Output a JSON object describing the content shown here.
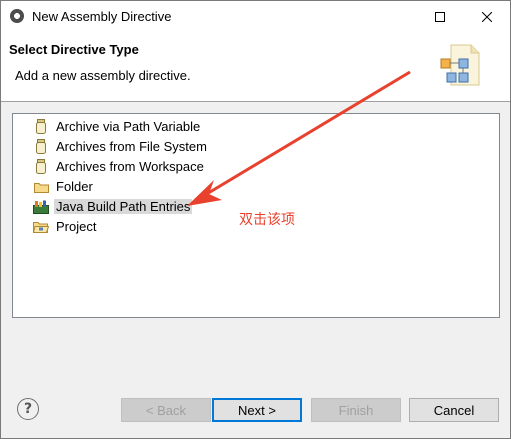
{
  "window": {
    "title": "New Assembly Directive",
    "controls": [
      "maximize-icon",
      "close-icon"
    ]
  },
  "header": {
    "title": "Select Directive Type",
    "description": "Add a new assembly directive.",
    "icon": "wizard-banner-icon"
  },
  "tree": {
    "items": [
      {
        "label": "Archive via Path Variable",
        "icon": "jar-icon"
      },
      {
        "label": "Archives from File System",
        "icon": "jar-icon"
      },
      {
        "label": "Archives from Workspace",
        "icon": "jar-icon"
      },
      {
        "label": "Folder",
        "icon": "folder-icon"
      },
      {
        "label": "Java Build Path Entries",
        "icon": "library-icon",
        "selected": true
      },
      {
        "label": "Project",
        "icon": "project-icon"
      }
    ]
  },
  "annotation": {
    "text": "双击该项",
    "color": "#e8412e"
  },
  "buttons": {
    "help": "?",
    "back": "< Back",
    "next": "Next >",
    "finish": "Finish",
    "cancel": "Cancel"
  },
  "colors": {
    "selection": "#d9d9d9",
    "default_button_border": "#0078d7",
    "annotation": "#e8412e"
  }
}
